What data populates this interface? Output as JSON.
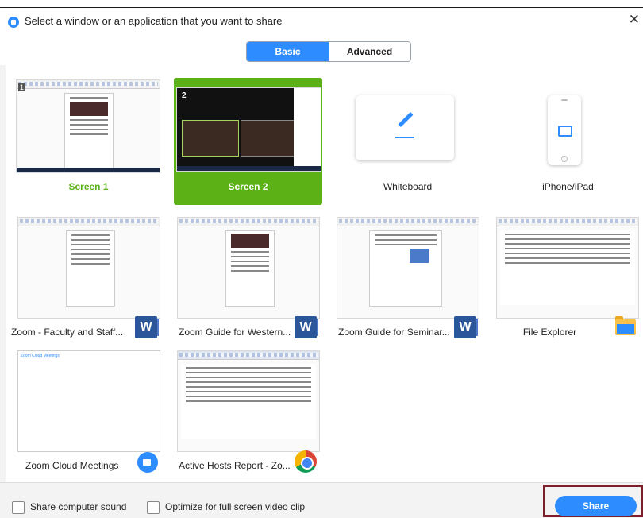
{
  "window": {
    "title": "Select a window or an application that you want to share",
    "close_glyph": "✕"
  },
  "tabs": [
    {
      "label": "Basic",
      "active": true
    },
    {
      "label": "Advanced",
      "active": false
    }
  ],
  "tiles": {
    "screen1": {
      "label": "Screen 1",
      "number": "1"
    },
    "screen2": {
      "label": "Screen 2",
      "number": "2"
    },
    "whiteboard": {
      "label": "Whiteboard"
    },
    "iphone": {
      "label": "iPhone/iPad"
    },
    "app1": {
      "label": "Zoom - Faculty and Staff...",
      "icon": "word-icon"
    },
    "app2": {
      "label": "Zoom Guide for Western...",
      "icon": "word-icon"
    },
    "app3": {
      "label": "Zoom Guide for Seminar...",
      "icon": "word-icon"
    },
    "app4": {
      "label": "File Explorer",
      "icon": "folder-icon"
    },
    "app5": {
      "label": "Zoom Cloud Meetings",
      "icon": "zoom-icon",
      "thumb_title": "Zoom Cloud Meetings"
    },
    "app6": {
      "label": "Active Hosts Report - Zo...",
      "icon": "chrome-icon"
    }
  },
  "footer": {
    "share_sound_label": "Share computer sound",
    "optimize_label": "Optimize for full screen video clip",
    "share_button_label": "Share"
  },
  "colors": {
    "accent": "#2d8cff",
    "selected": "#5bb115",
    "highlight": "#7a1f2b"
  }
}
